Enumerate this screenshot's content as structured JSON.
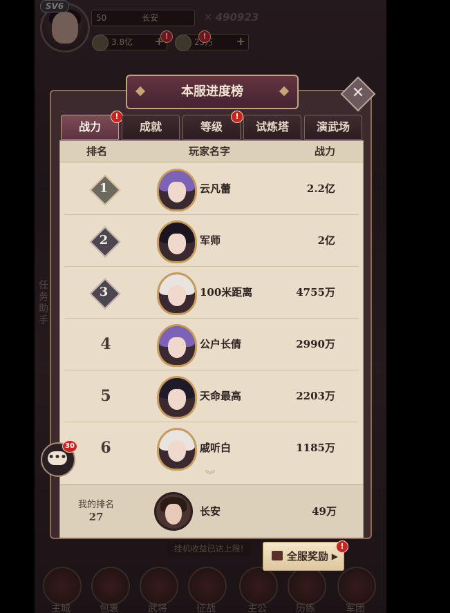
{
  "hud": {
    "vip": "SV6",
    "level": "50",
    "player_name": "长安",
    "power_value": "490923",
    "silver": "3.8亿",
    "food": "23万",
    "plus": "+"
  },
  "side": {
    "task_helper": "任务助手"
  },
  "bottom_nav": [
    "主城",
    "包裹",
    "武将",
    "征战",
    "主公",
    "历练",
    "军团"
  ],
  "notice": "挂机收益已达上限!",
  "panel": {
    "title": "本服进度榜",
    "close": "✕",
    "tabs": [
      {
        "label": "战力",
        "active": true,
        "badge": "!"
      },
      {
        "label": "成就",
        "active": false
      },
      {
        "label": "等级",
        "active": false,
        "badge": "!"
      },
      {
        "label": "试炼塔",
        "active": false
      },
      {
        "label": "演武场",
        "active": false
      }
    ],
    "columns": {
      "rank": "排名",
      "name": "玩家名字",
      "power": "战力"
    },
    "rows": [
      {
        "rank": "1",
        "name": "云凡蕾",
        "power": "2.2亿"
      },
      {
        "rank": "2",
        "name": "军师",
        "power": "2亿"
      },
      {
        "rank": "3",
        "name": "100米距离",
        "power": "4755万"
      },
      {
        "rank": "4",
        "name": "公户长倩",
        "power": "2990万"
      },
      {
        "rank": "5",
        "name": "天命最高",
        "power": "2203万"
      },
      {
        "rank": "6",
        "name": "戚听白",
        "power": "1185万"
      }
    ],
    "more": "︾",
    "my_rank": {
      "label": "我的排名",
      "value": "27",
      "name": "长安",
      "power": "49万"
    }
  },
  "chat": {
    "badge": "30"
  },
  "reward_button": {
    "label": "全服奖励",
    "badge": "!"
  },
  "colors": {
    "tab_active": "#7d4c56",
    "paper": "#e9ddc9",
    "badge_red": "#c8231f",
    "frame_gold": "#c6a47e"
  }
}
